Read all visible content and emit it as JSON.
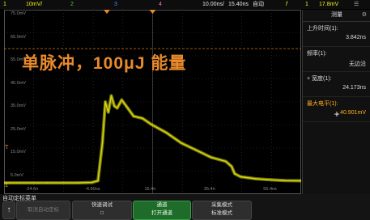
{
  "topbar": {
    "ch1_num": "1",
    "ch1_scale": "10mV/",
    "ch2_num": "2",
    "ch3_num": "3",
    "ch4_num": "4",
    "timebase": "10.00ns/",
    "delay": "15.40ns",
    "mode": "自动",
    "trig_icon": "f",
    "trig_ch": "1",
    "trig_level": "17.8mV"
  },
  "overlay": {
    "title": "单脉冲，100μJ 能量"
  },
  "axis": {
    "v_labels": [
      "75.0mV",
      "65.0mV",
      "55.0mV",
      "45.0mV",
      "35.0mV",
      "25.0mV",
      "15.0mV",
      "5.0mV",
      "-4.97mV"
    ],
    "h_labels": [
      "-24.6n",
      "-4.60ns",
      "15.4n",
      "35.4n",
      "55.4ns"
    ]
  },
  "panel": {
    "header": "测量",
    "rows": [
      {
        "key": "上升时间(1):",
        "val": "3.842ns"
      },
      {
        "key": "频率(1):",
        "val": "无边沿"
      },
      {
        "key": "+ 宽度(1):",
        "val": "24.173ns"
      },
      {
        "key": "最大电平(1):",
        "val": "40.901mV"
      }
    ],
    "plus": "+"
  },
  "bottom": {
    "label": "自动定标菜单",
    "undo": "取消自动定标",
    "quick_title": "快速调试",
    "quick_state": "□",
    "chan_title": "通道",
    "chan_state": "打开通道",
    "acq_title": "采集模式",
    "acq_state": "标准模式",
    "home_icon": "↑"
  },
  "colors": {
    "trace": "#d8d80f",
    "grid": "#3a3a3a",
    "ref_line": "#d07a1a"
  },
  "chart_data": {
    "type": "line",
    "title": "",
    "xlabel": "",
    "ylabel": "",
    "x_unit": "ns",
    "y_unit": "mV",
    "xlim": [
      -34.6,
      65.4
    ],
    "ylim": [
      -5,
      85
    ],
    "series": [
      {
        "values_x": [
          -34.6,
          -20,
          -10,
          -5,
          -3.0,
          -1.5,
          -0.5,
          0.5,
          1.5,
          2.5,
          3.5,
          5,
          7,
          9,
          12,
          15,
          20,
          25,
          30,
          35,
          40,
          42,
          43,
          45,
          50,
          55,
          60,
          65.4
        ],
        "values_y": [
          0.5,
          0.5,
          0.5,
          0.7,
          1.5,
          20,
          40,
          35,
          43,
          38,
          37,
          41,
          37,
          33,
          32,
          29,
          25,
          20,
          16.5,
          13,
          11,
          8.5,
          5,
          3.5,
          2.5,
          2.0,
          1.6,
          1.5
        ]
      }
    ],
    "grid": true
  }
}
